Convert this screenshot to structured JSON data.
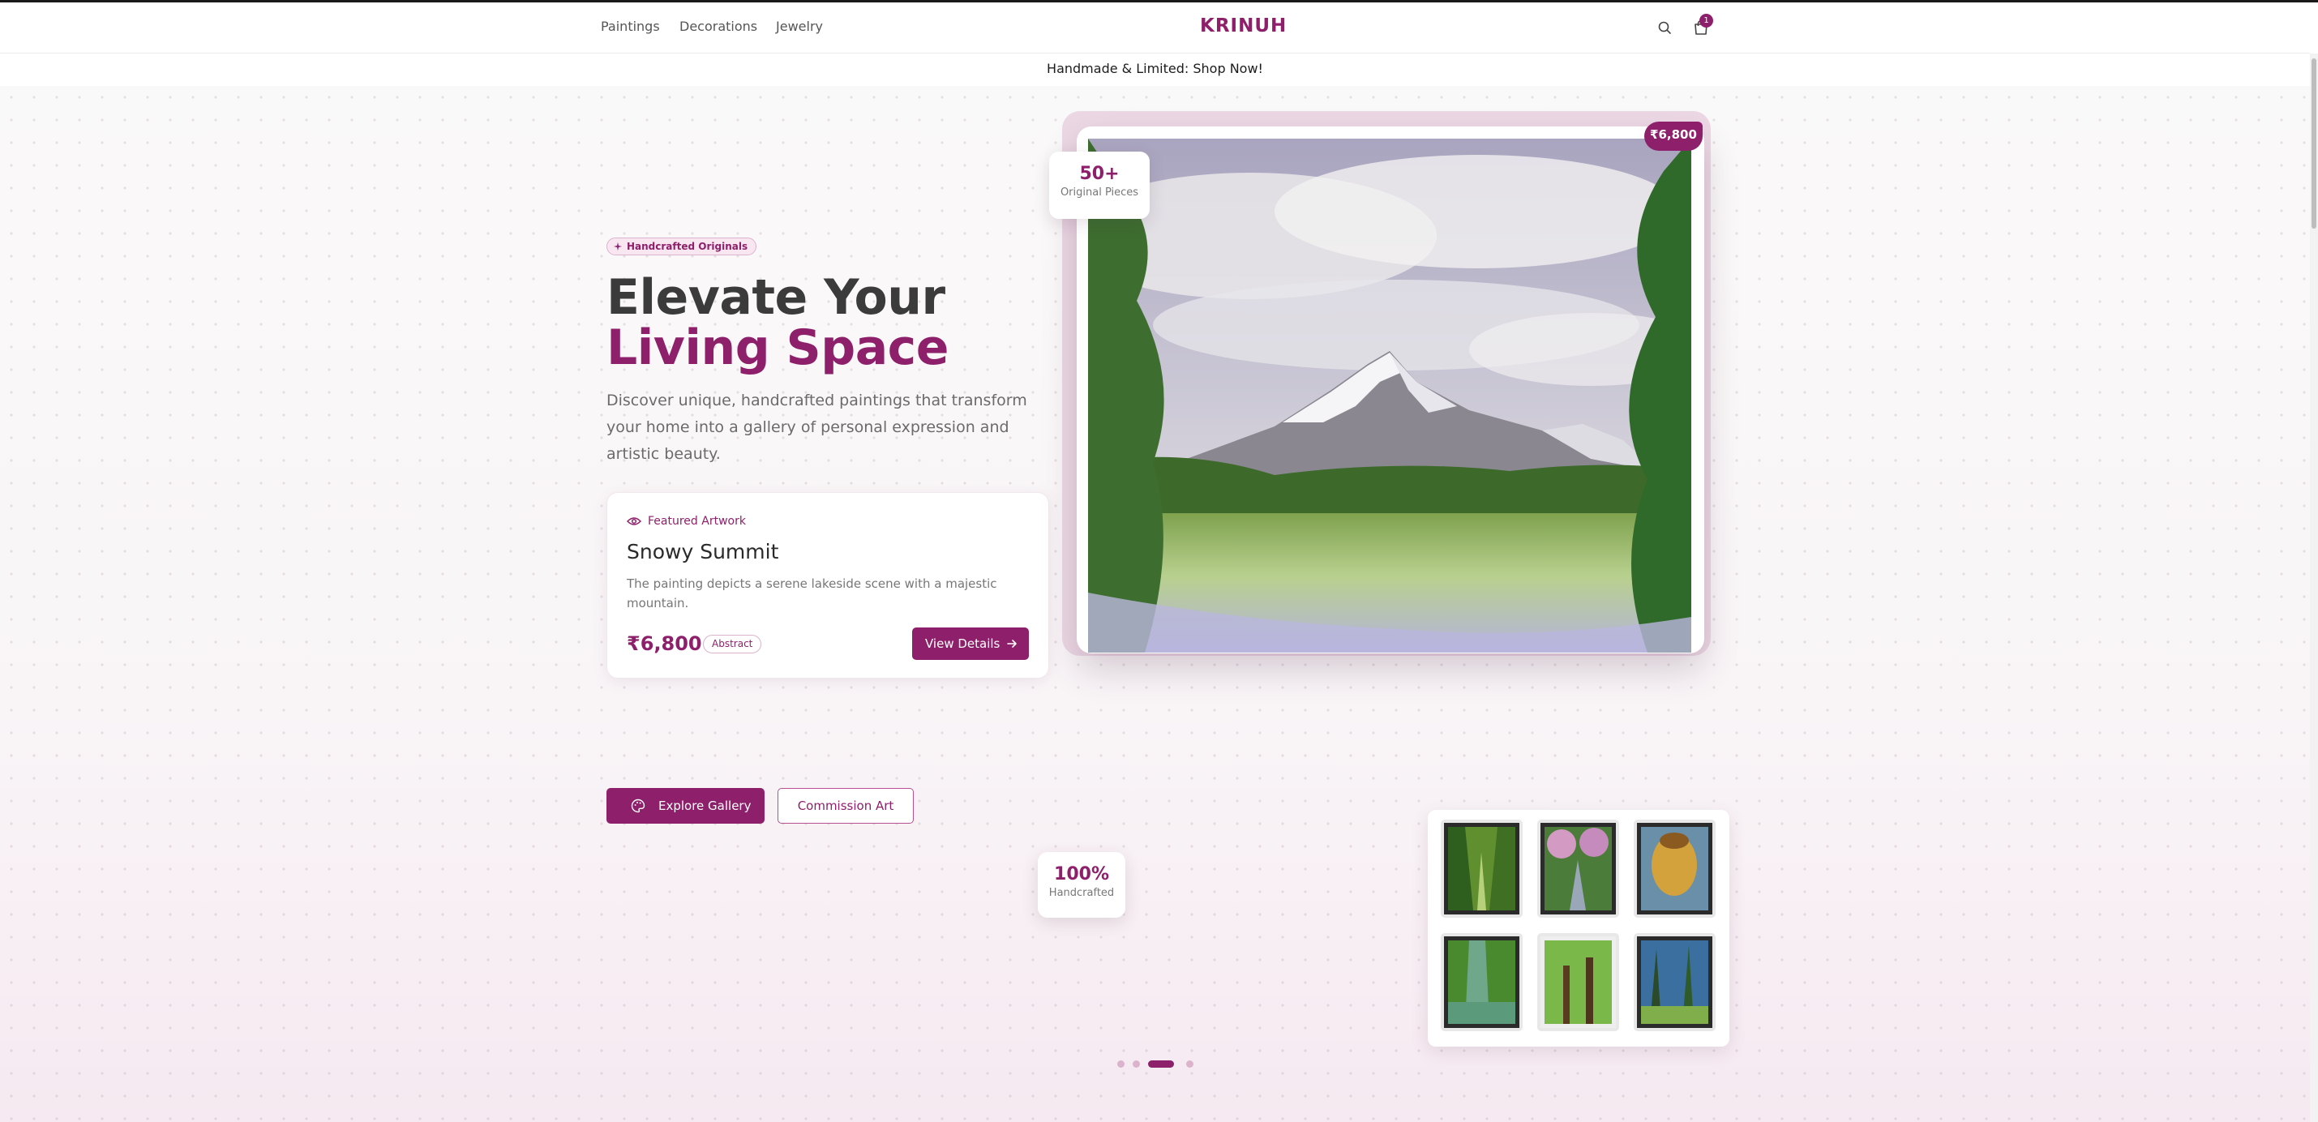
{
  "header": {
    "nav": [
      "Paintings",
      "Decorations",
      "Jewelry"
    ],
    "brand": "KRINUH",
    "cart_count": "1",
    "icons": [
      "search-icon",
      "shopping-bag-icon"
    ]
  },
  "announcement": "Handmade & Limited: Shop Now!",
  "hero": {
    "badge": "Handcrafted Originals",
    "headline_line1": "Elevate Your",
    "headline_line2": "Living Space",
    "lead": "Discover unique, handcrafted paintings that transform your home into a gallery of personal expression and artistic beauty.",
    "featured": {
      "label": "Featured Artwork",
      "title": "Snowy Summit",
      "description": "The painting depicts a serene lakeside scene with a majestic mountain.",
      "price": "₹6,800",
      "tag": "Abstract",
      "button": "View Details"
    },
    "buttons": {
      "explore": "Explore Gallery",
      "commission": "Commission Art"
    },
    "price_tag": "₹6,800",
    "stats": [
      {
        "value": "50+",
        "label": "Original Pieces"
      },
      {
        "value": "100%",
        "label": "Handcrafted"
      }
    ],
    "carousel": {
      "count": 4,
      "active": 3
    }
  },
  "colors": {
    "brand": "#8e1f6b",
    "brand_light": "#f8e6f0"
  }
}
